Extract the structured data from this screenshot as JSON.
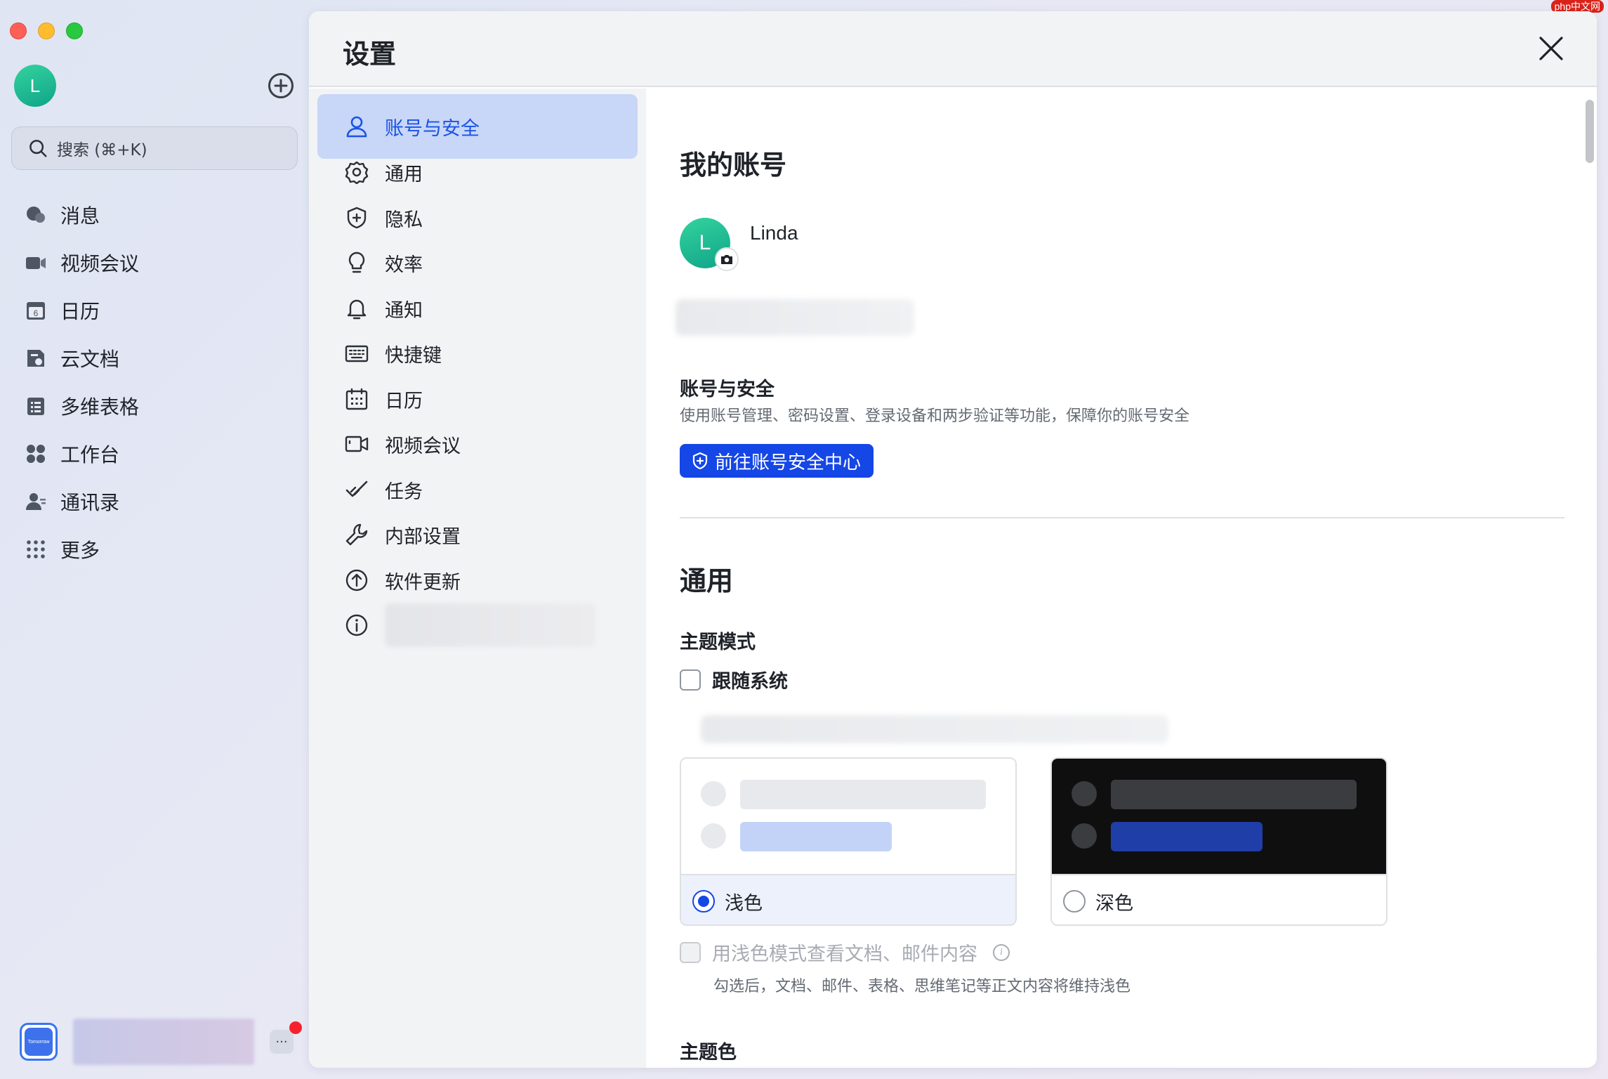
{
  "app": {
    "avatar_letter": "L",
    "search_placeholder": "搜索 (⌘+K)",
    "nav": [
      {
        "label": "消息",
        "icon": "chat-bubble-icon"
      },
      {
        "label": "视频会议",
        "icon": "video-camera-icon"
      },
      {
        "label": "日历",
        "icon": "calendar-icon"
      },
      {
        "label": "云文档",
        "icon": "cloud-doc-icon"
      },
      {
        "label": "多维表格",
        "icon": "table-icon"
      },
      {
        "label": "工作台",
        "icon": "workplace-grid-icon"
      },
      {
        "label": "通讯录",
        "icon": "contacts-icon"
      },
      {
        "label": "更多",
        "icon": "more-dots-icon"
      }
    ],
    "calendar_day": "6",
    "tomorrow_label": "Tomorrow",
    "more_ellipsis": "···"
  },
  "settings": {
    "title": "设置",
    "nav": [
      {
        "label": "账号与安全",
        "icon": "user-icon",
        "active": true
      },
      {
        "label": "通用",
        "icon": "gear-icon"
      },
      {
        "label": "隐私",
        "icon": "shield-icon"
      },
      {
        "label": "效率",
        "icon": "lightbulb-icon"
      },
      {
        "label": "通知",
        "icon": "bell-icon"
      },
      {
        "label": "快捷键",
        "icon": "keyboard-icon"
      },
      {
        "label": "日历",
        "icon": "calendar-icon"
      },
      {
        "label": "视频会议",
        "icon": "video-icon"
      },
      {
        "label": "任务",
        "icon": "task-check-icon"
      },
      {
        "label": "内部设置",
        "icon": "wrench-icon"
      },
      {
        "label": "软件更新",
        "icon": "upload-arrow-icon"
      },
      {
        "label": "",
        "icon": "info-icon"
      }
    ],
    "account": {
      "heading": "我的账号",
      "avatar_letter": "L",
      "name": "Linda",
      "security_title": "账号与安全",
      "security_desc": "使用账号管理、密码设置、登录设备和两步验证等功能，保障你的账号安全",
      "security_button": "前往账号安全中心"
    },
    "general": {
      "heading": "通用",
      "theme_mode_title": "主题模式",
      "follow_system": "跟随系统",
      "light_label": "浅色",
      "dark_label": "深色",
      "light_docs_label": "用浅色模式查看文档、邮件内容",
      "light_docs_desc": "勾选后，文档、邮件、表格、思维笔记等正文内容将维持浅色",
      "theme_color_title": "主题色"
    }
  },
  "watermark": "php中文网",
  "colors": {
    "accent": "#1546e6",
    "active_nav_bg": "#c8d6f7",
    "avatar_green": "#1bb592"
  }
}
